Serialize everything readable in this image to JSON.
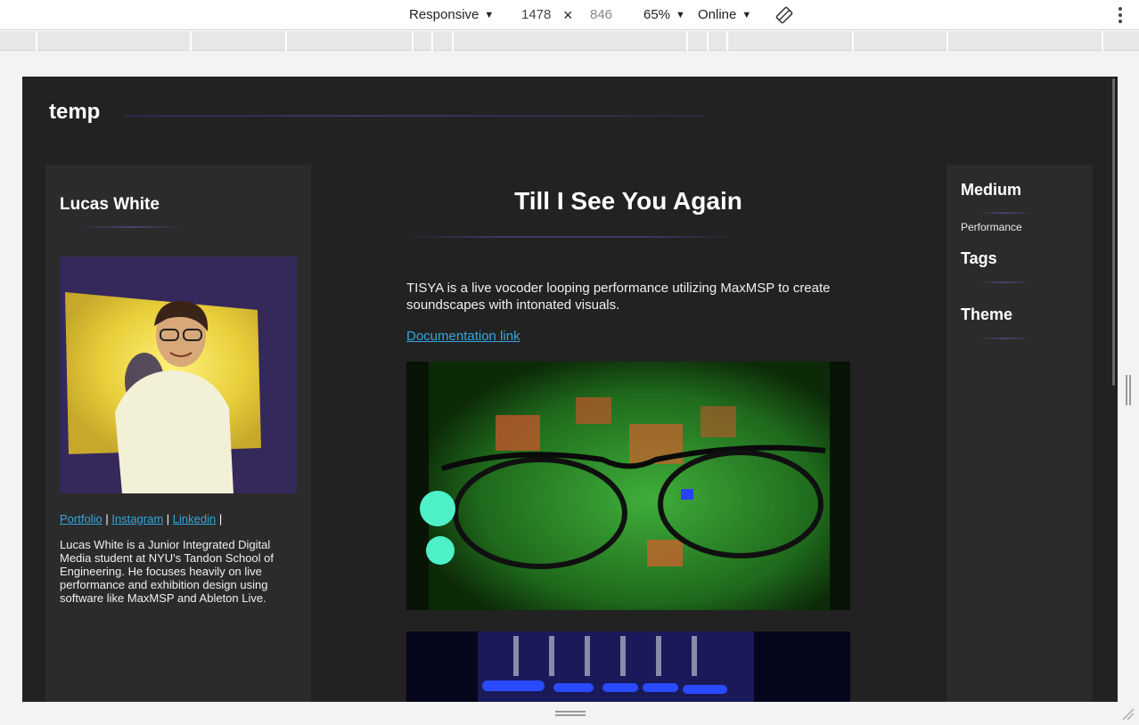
{
  "devtools": {
    "device_mode": "Responsive",
    "width": "1478",
    "height": "846",
    "zoom": "65%",
    "network": "Online"
  },
  "site": {
    "title": "temp"
  },
  "author": {
    "name": "Lucas White",
    "links": [
      "Portfolio",
      "Instagram",
      "Linkedin"
    ],
    "separator": "|",
    "bio": "Lucas White is a Junior Integrated Digital Media student at NYU's Tandon School of Engineering. He focuses heavily on live performance and exhibition design using software like MaxMSP and Ableton Live."
  },
  "post": {
    "title": "Till I See You Again",
    "description": "TISYA is a live vocoder looping performance utilizing MaxMSP to create soundscapes with intonated visuals.",
    "doc_link": "Documentation link"
  },
  "meta": {
    "medium_heading": "Medium",
    "medium_value": "Performance",
    "tags_heading": "Tags",
    "theme_heading": "Theme"
  },
  "colors": {
    "page_bg": "#222222",
    "panel_bg": "#2b2b2b",
    "link": "#33a7dd",
    "accent_rule": "#3b3b6e"
  },
  "icons": {
    "caret": "▼",
    "close": "×",
    "rotate": "rotate-icon",
    "menu": "kebab-icon"
  }
}
